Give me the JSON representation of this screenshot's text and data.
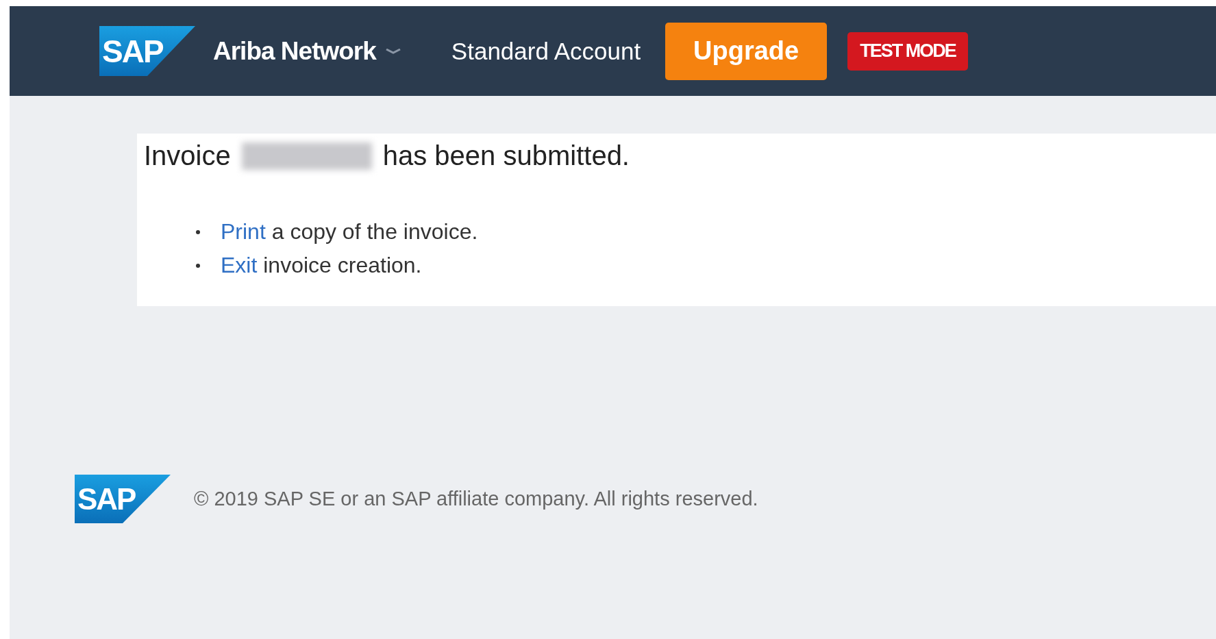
{
  "header": {
    "logo": "SAP",
    "product": "Ariba Network",
    "account": "Standard Account",
    "upgrade_button": "Upgrade",
    "mode_badge": "TEST MODE"
  },
  "confirmation": {
    "before": "Invoice",
    "after": "has been submitted.",
    "redacted": true
  },
  "actions": [
    {
      "link": "Print",
      "text": "a copy of the invoice."
    },
    {
      "link": "Exit",
      "text": "invoice creation."
    }
  ],
  "footer": {
    "logo": "SAP",
    "copyright": "© 2019 SAP SE or an SAP affiliate company. All rights reserved."
  }
}
